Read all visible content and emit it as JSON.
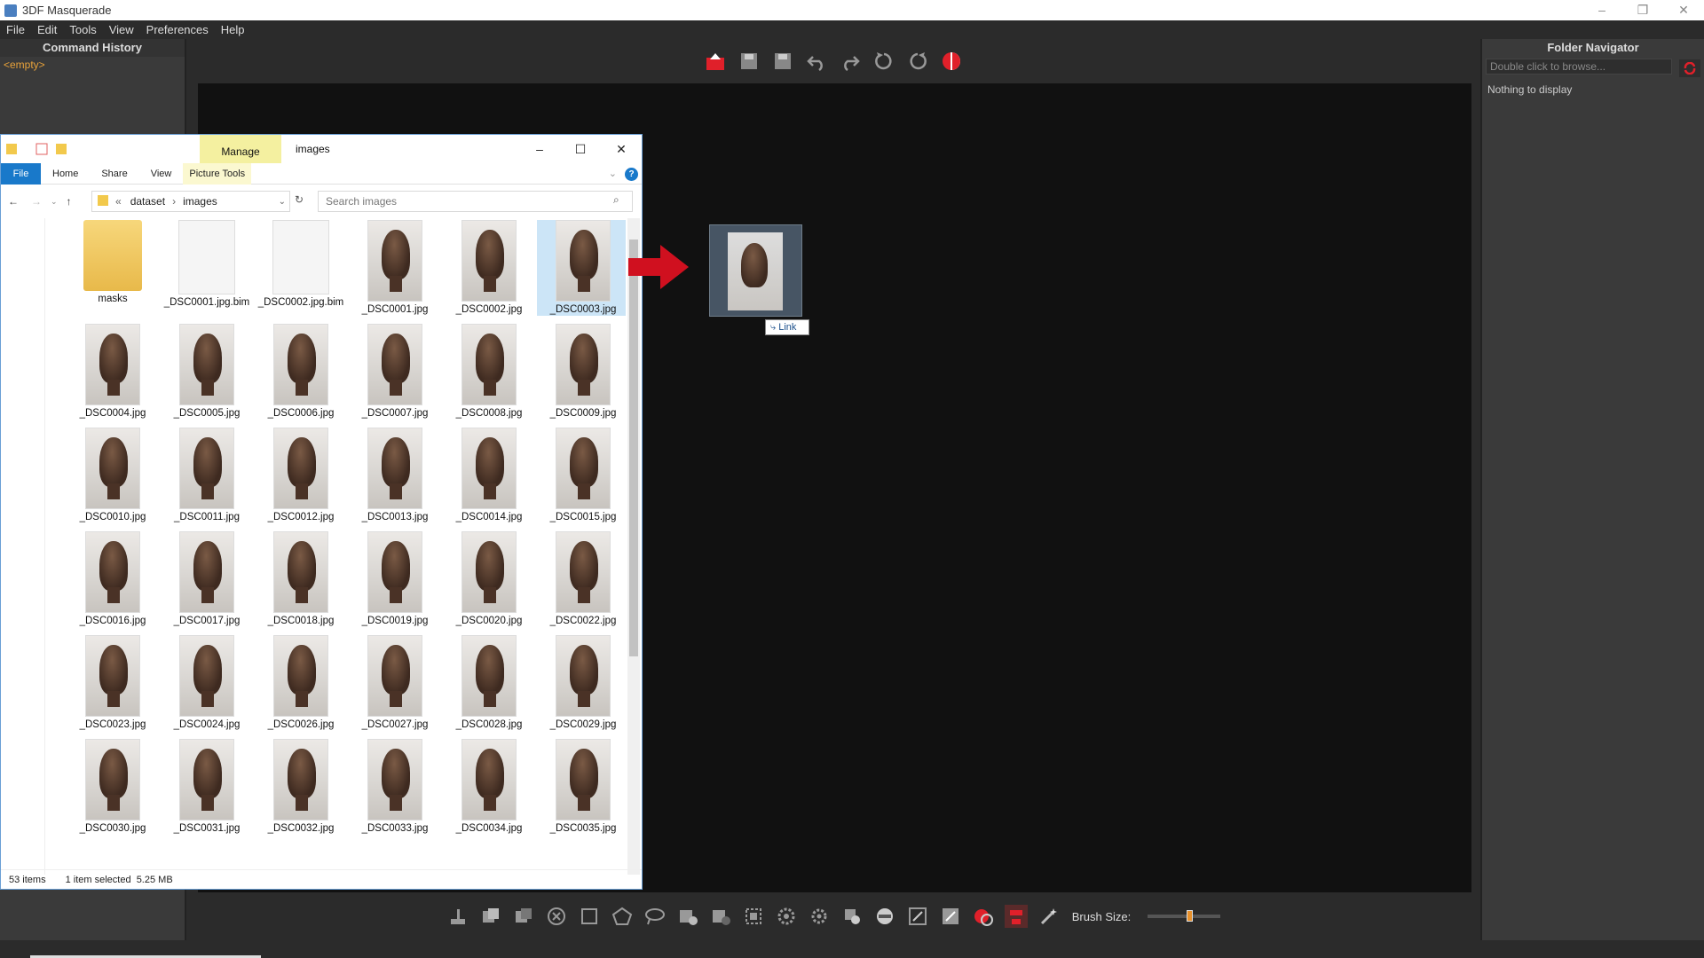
{
  "app": {
    "title": "3DF Masquerade"
  },
  "menu": [
    "File",
    "Edit",
    "Tools",
    "View",
    "Preferences",
    "Help"
  ],
  "left_panel": {
    "title": "Command History",
    "empty_text": "<empty>"
  },
  "right_panel": {
    "title": "Folder Navigator",
    "browse_placeholder": "Double click to browse...",
    "nothing": "Nothing to display"
  },
  "bottom_toolbar": {
    "brush_label": "Brush Size:",
    "brush_size_fraction": 0.5
  },
  "drag": {
    "link_label": "Link"
  },
  "colors": {
    "accent_red": "#e0202a",
    "brush_orange": "#e8912c",
    "panel_bg": "#3a3a3a",
    "canvas_bg": "#111111"
  },
  "explorer": {
    "manage_label": "Manage",
    "folder_title": "images",
    "tabs": [
      "Home",
      "Share",
      "View"
    ],
    "file_tab": "File",
    "picture_tools": "Picture Tools",
    "breadcrumb": {
      "prefix": "«",
      "part1": "dataset",
      "sep": "›",
      "part2": "images"
    },
    "search_placeholder": "Search images",
    "items": [
      {
        "name": "masks",
        "kind": "folder"
      },
      {
        "name": "_DSC0001.jpg.bim",
        "kind": "doc"
      },
      {
        "name": "_DSC0002.jpg.bim",
        "kind": "doc"
      },
      {
        "name": "_DSC0001.jpg",
        "kind": "img"
      },
      {
        "name": "_DSC0002.jpg",
        "kind": "img"
      },
      {
        "name": "_DSC0003.jpg",
        "kind": "img",
        "selected": true
      },
      {
        "name": "_DSC0004.jpg",
        "kind": "img"
      },
      {
        "name": "_DSC0005.jpg",
        "kind": "img"
      },
      {
        "name": "_DSC0006.jpg",
        "kind": "img"
      },
      {
        "name": "_DSC0007.jpg",
        "kind": "img"
      },
      {
        "name": "_DSC0008.jpg",
        "kind": "img"
      },
      {
        "name": "_DSC0009.jpg",
        "kind": "img"
      },
      {
        "name": "_DSC0010.jpg",
        "kind": "img"
      },
      {
        "name": "_DSC0011.jpg",
        "kind": "img"
      },
      {
        "name": "_DSC0012.jpg",
        "kind": "img"
      },
      {
        "name": "_DSC0013.jpg",
        "kind": "img"
      },
      {
        "name": "_DSC0014.jpg",
        "kind": "img"
      },
      {
        "name": "_DSC0015.jpg",
        "kind": "img"
      },
      {
        "name": "_DSC0016.jpg",
        "kind": "img"
      },
      {
        "name": "_DSC0017.jpg",
        "kind": "img"
      },
      {
        "name": "_DSC0018.jpg",
        "kind": "img"
      },
      {
        "name": "_DSC0019.jpg",
        "kind": "img"
      },
      {
        "name": "_DSC0020.jpg",
        "kind": "img"
      },
      {
        "name": "_DSC0022.jpg",
        "kind": "img"
      },
      {
        "name": "_DSC0023.jpg",
        "kind": "img"
      },
      {
        "name": "_DSC0024.jpg",
        "kind": "img"
      },
      {
        "name": "_DSC0026.jpg",
        "kind": "img"
      },
      {
        "name": "_DSC0027.jpg",
        "kind": "img"
      },
      {
        "name": "_DSC0028.jpg",
        "kind": "img"
      },
      {
        "name": "_DSC0029.jpg",
        "kind": "img"
      },
      {
        "name": "_DSC0030.jpg",
        "kind": "img"
      },
      {
        "name": "_DSC0031.jpg",
        "kind": "img"
      },
      {
        "name": "_DSC0032.jpg",
        "kind": "img"
      },
      {
        "name": "_DSC0033.jpg",
        "kind": "img"
      },
      {
        "name": "_DSC0034.jpg",
        "kind": "img"
      },
      {
        "name": "_DSC0035.jpg",
        "kind": "img"
      }
    ],
    "status_count": "53 items",
    "status_selected": "1 item selected",
    "status_size": "5.25 MB"
  }
}
